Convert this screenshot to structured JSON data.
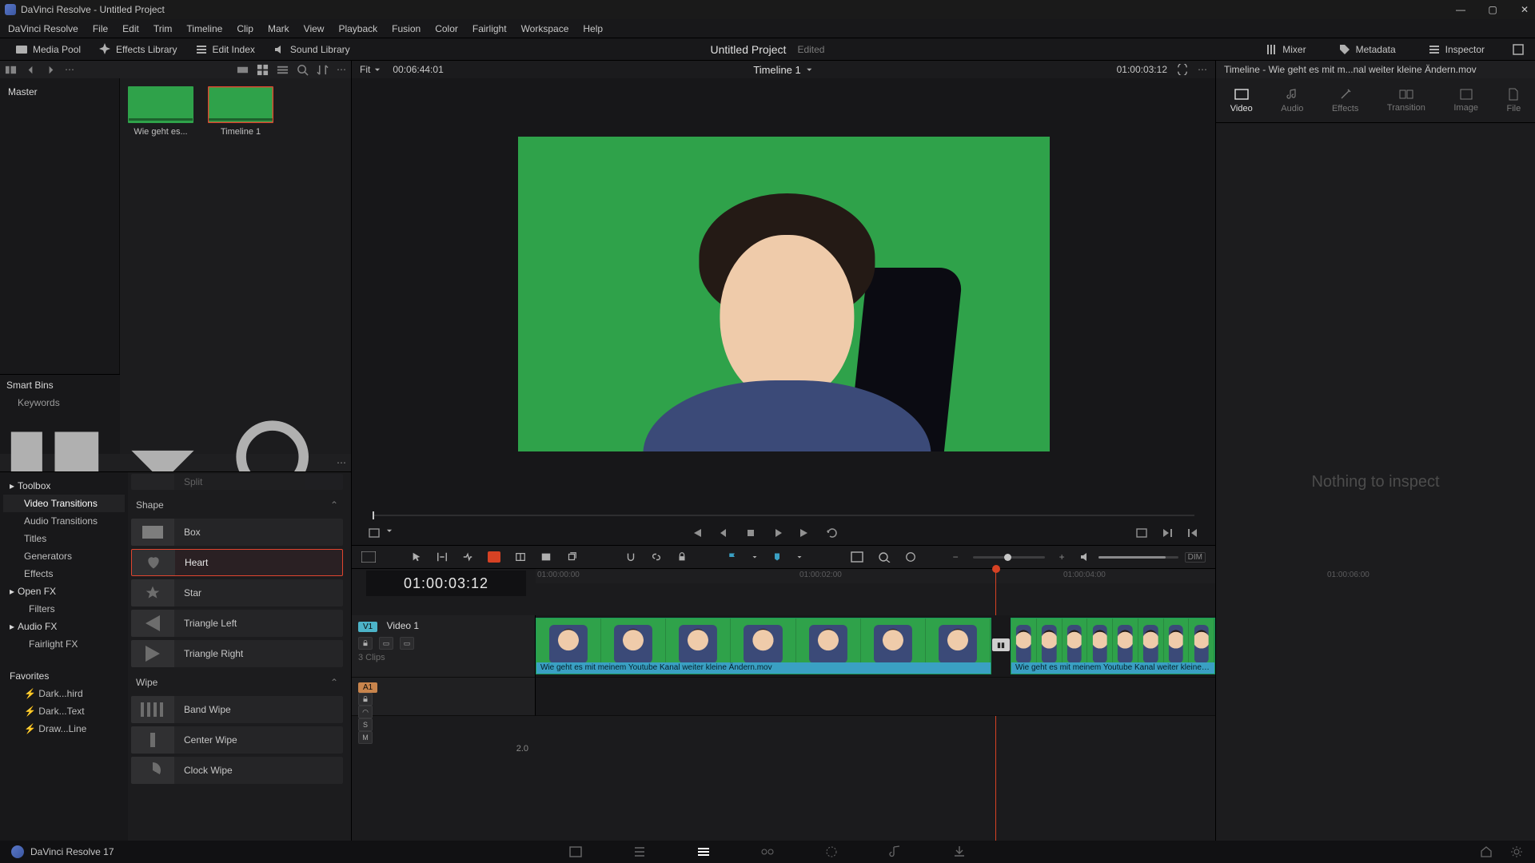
{
  "titlebar": {
    "app": "DaVinci Resolve",
    "doc": "Untitled Project"
  },
  "menu": [
    "DaVinci Resolve",
    "File",
    "Edit",
    "Trim",
    "Timeline",
    "Clip",
    "Mark",
    "View",
    "Playback",
    "Fusion",
    "Color",
    "Fairlight",
    "Workspace",
    "Help"
  ],
  "toolbar": {
    "media_pool": "Media Pool",
    "effects_library": "Effects Library",
    "edit_index": "Edit Index",
    "sound_library": "Sound Library",
    "mixer": "Mixer",
    "metadata": "Metadata",
    "inspector": "Inspector"
  },
  "project": {
    "name": "Untitled Project",
    "status": "Edited"
  },
  "pool": {
    "master": "Master",
    "clip1": "Wie geht es...",
    "clip2": "Timeline 1",
    "smartbins": "Smart Bins",
    "keywords": "Keywords"
  },
  "viewer": {
    "fit": "Fit",
    "src_tc": "00:06:44:01",
    "timeline_name": "Timeline 1",
    "rec_tc": "01:00:03:12",
    "clip_name": "Timeline - Wie geht es mit m...nal weiter kleine Ändern.mov"
  },
  "fx": {
    "tree": [
      {
        "label": "Toolbox",
        "head": true
      },
      {
        "label": "Video Transitions",
        "sel": true
      },
      {
        "label": "Audio Transitions"
      },
      {
        "label": "Titles"
      },
      {
        "label": "Generators"
      },
      {
        "label": "Effects"
      },
      {
        "label": "Open FX",
        "head": true
      },
      {
        "label": "Filters",
        "sub": true
      },
      {
        "label": "Audio FX",
        "head": true
      },
      {
        "label": "Fairlight FX",
        "sub": true
      }
    ],
    "favorites": "Favorites",
    "fav_items": [
      "Dark...hird",
      "Dark...Text",
      "Draw...Line"
    ],
    "group_split": "Split",
    "group_shape": "Shape",
    "shape_items": [
      "Box",
      "Heart",
      "Star",
      "Triangle Left",
      "Triangle Right"
    ],
    "shape_sel": 1,
    "group_wipe": "Wipe",
    "wipe_items": [
      "Band Wipe",
      "Center Wipe",
      "Clock Wipe"
    ]
  },
  "inspector": {
    "header": "Timeline - Wie geht es mit m...nal weiter kleine Ändern.mov",
    "tabs": [
      "Video",
      "Audio",
      "Effects",
      "Transition",
      "Image",
      "File"
    ],
    "empty": "Nothing to inspect"
  },
  "timeline": {
    "tc_display": "01:00:03:12",
    "ticks": [
      "01:00:00:00",
      "01:00:02:00",
      "01:00:04:00",
      "01:00:06:00"
    ],
    "v1_tag": "V1",
    "v1_name": "Video 1",
    "v1_info": "3 Clips",
    "a1_tag": "A1",
    "a_scale": "2.0",
    "clip_a": "Wie geht es mit meinem Youtube Kanal weiter kleine Ändern.mov",
    "clip_b": "Wie geht es mit meinem Youtube Kanal weiter kleine Ändern.mov",
    "dim": "DIM"
  },
  "footer": {
    "version": "DaVinci Resolve 17"
  }
}
